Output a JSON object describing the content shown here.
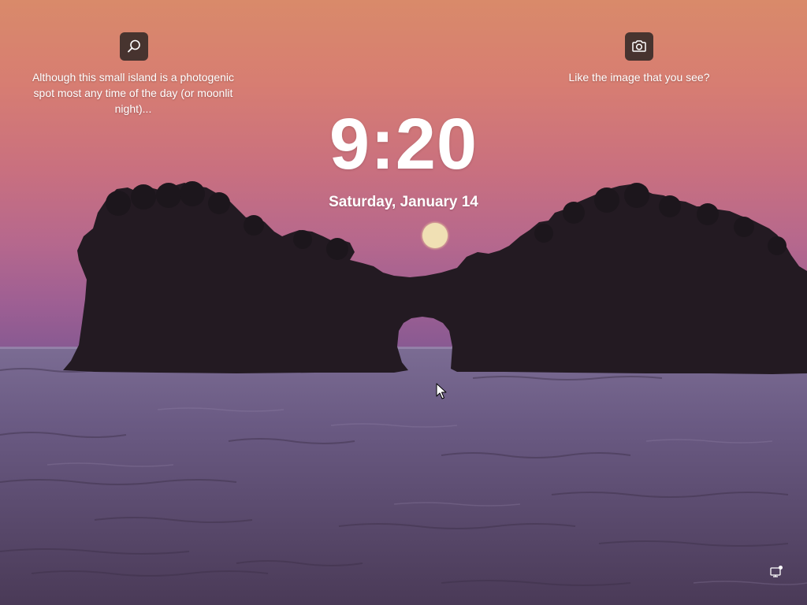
{
  "spotlight": {
    "search_icon": "search-icon",
    "caption": "Although this small island is a photogenic spot most any time of the day (or moonlit night)..."
  },
  "like_image": {
    "camera_icon": "camera-icon",
    "caption": "Like the image that you see?"
  },
  "clock": {
    "time": "9:20",
    "date": "Saturday, January 14"
  },
  "status": {
    "network_icon": "network-icon"
  },
  "colors": {
    "icon_button_bg": "#1e1e1e",
    "text": "#ffffff"
  }
}
